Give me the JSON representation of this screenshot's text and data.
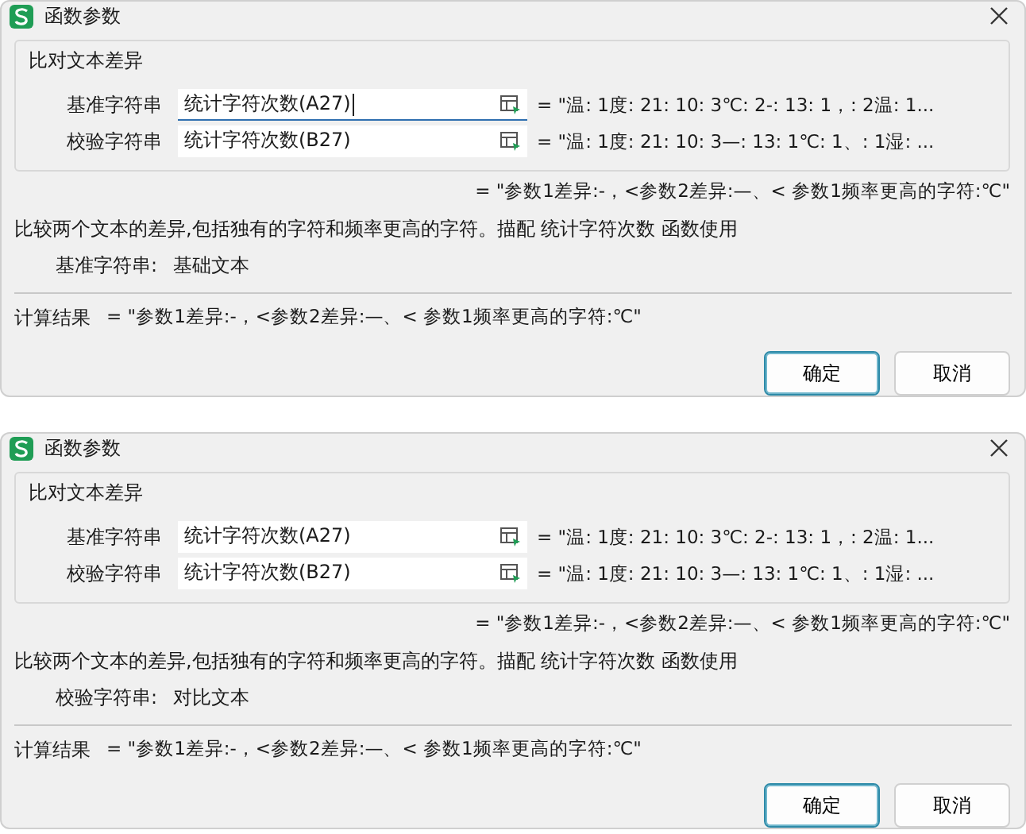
{
  "dialogs": [
    {
      "title": "函数参数",
      "group": {
        "title": "比对文本差异",
        "args": [
          {
            "label": "基准字符串",
            "value": "统计字符次数(A27)",
            "focused": true,
            "preview": "= \"温: 1度: 21: 10: 3℃: 2-: 13: 1，: 2温: 1..."
          },
          {
            "label": "校验字符串",
            "value": "统计字符次数(B27)",
            "focused": false,
            "preview": "= \"温: 1度: 21: 10: 3—: 13: 1℃: 1、: 1湿: ..."
          }
        ]
      },
      "result_preview": "= \"参数1差异:-，<参数2差异:—、< 参数1频率更高的字符:℃\"",
      "description": "比较两个文本的差异,包括独有的字符和频率更高的字符。描配 统计字符次数 函数使用",
      "param_label": "基准字符串:",
      "param_desc": "基础文本",
      "calc_label": "计算结果",
      "calc_value": "= \"参数1差异:-，<参数2差异:—、< 参数1频率更高的字符:℃\"",
      "buttons": [
        {
          "label": "确定",
          "primary": true
        },
        {
          "label": "取消",
          "primary": false
        }
      ]
    },
    {
      "title": "函数参数",
      "group": {
        "title": "比对文本差异",
        "args": [
          {
            "label": "基准字符串",
            "value": "统计字符次数(A27)",
            "focused": false,
            "preview": "= \"温: 1度: 21: 10: 3℃: 2-: 13: 1，: 2温: 1..."
          },
          {
            "label": "校验字符串",
            "value": "统计字符次数(B27)",
            "focused": false,
            "preview": "= \"温: 1度: 21: 10: 3—: 13: 1℃: 1、: 1湿: ..."
          }
        ]
      },
      "result_preview": "= \"参数1差异:-，<参数2差异:—、< 参数1频率更高的字符:℃\"",
      "description": "比较两个文本的差异,包括独有的字符和频率更高的字符。描配 统计字符次数 函数使用",
      "param_label": "校验字符串:",
      "param_desc": "对比文本",
      "calc_label": "计算结果",
      "calc_value": "= \"参数1差异:-，<参数2差异:—、< 参数1频率更高的字符:℃\"",
      "buttons": [
        {
          "label": "确定",
          "primary": true
        },
        {
          "label": "取消",
          "primary": false
        }
      ]
    }
  ]
}
